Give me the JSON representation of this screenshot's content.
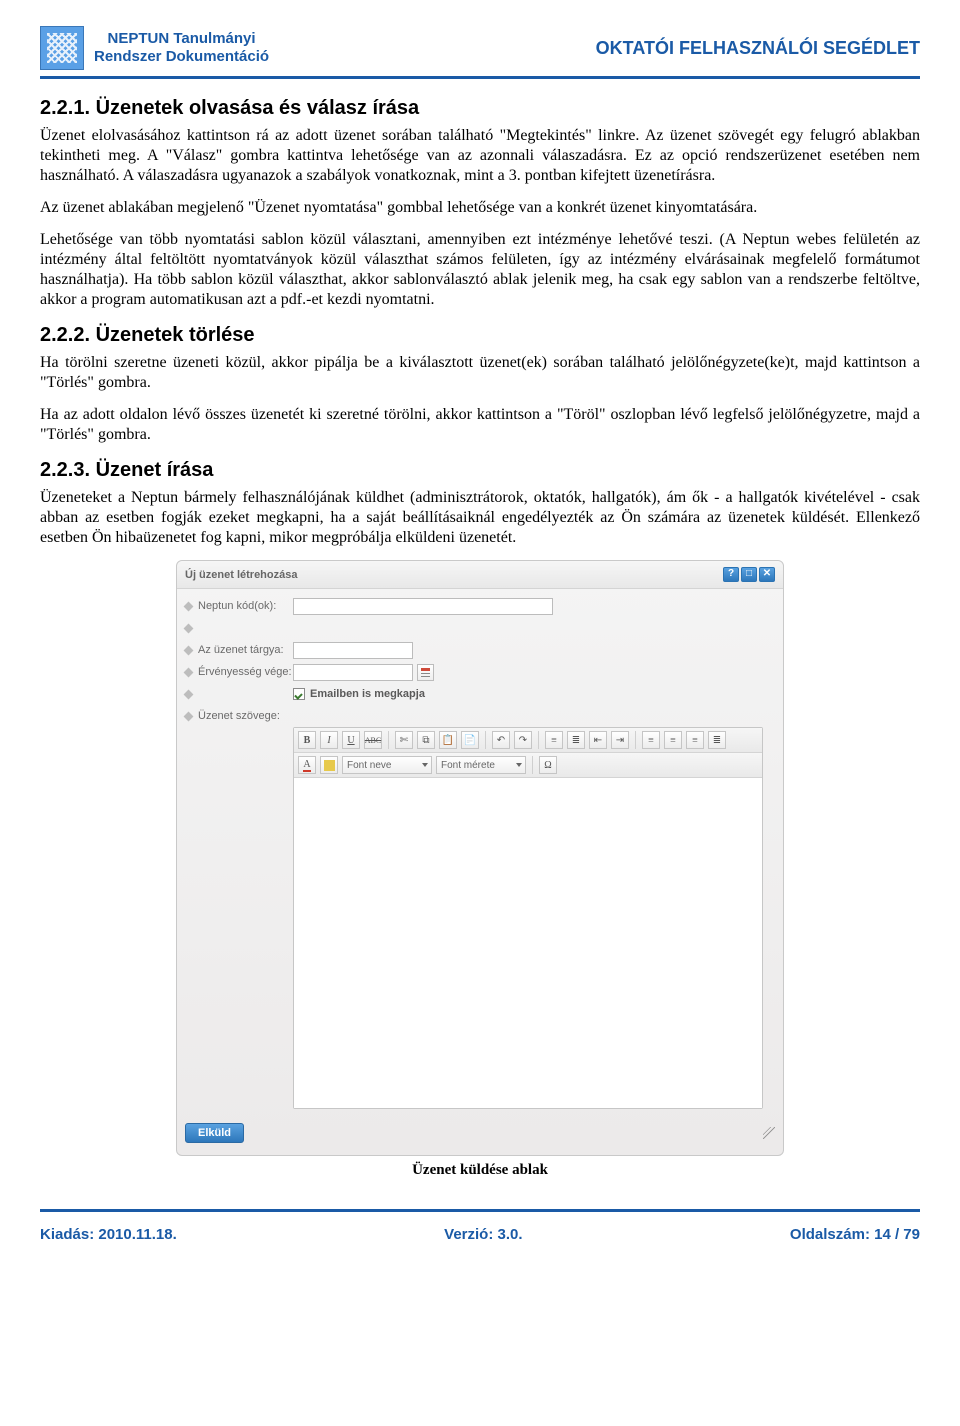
{
  "header": {
    "brand_line1": "NEPTUN Tanulmányi",
    "brand_line2": "Rendszer Dokumentáció",
    "title": "OKTATÓI FELHASZNÁLÓI SEGÉDLET"
  },
  "sections": {
    "s1": {
      "heading": "2.2.1. Üzenetek olvasása és válasz írása",
      "p1": "Üzenet elolvasásához kattintson rá az adott üzenet sorában található \"Megtekintés\" linkre. Az üzenet szövegét egy felugró ablakban tekintheti meg. A \"Válasz\" gombra kattintva lehetősége van az azonnali válaszadásra. Ez az opció rendszerüzenet esetében nem használható. A válaszadásra ugyanazok a szabályok vonatkoznak, mint a 3. pontban kifejtett üzenetírásra.",
      "p2": "Az üzenet ablakában megjelenő \"Üzenet nyomtatása\" gombbal lehetősége van a konkrét üzenet kinyomtatására.",
      "p3": "Lehetősége van több nyomtatási sablon közül választani, amennyiben ezt intézménye lehetővé teszi. (A Neptun webes felületén az intézmény által feltöltött nyomtatványok közül választhat számos felületen, így az intézmény elvárásainak megfelelő formátumot használhatja). Ha több sablon közül választhat, akkor sablonválasztó ablak jelenik meg, ha csak egy sablon van a rendszerbe feltöltve, akkor a program automatikusan azt a pdf.-et kezdi nyomtatni."
    },
    "s2": {
      "heading": "2.2.2. Üzenetek törlése",
      "p1": "Ha törölni szeretne üzeneti közül, akkor pipálja be a kiválasztott üzenet(ek) sorában található jelölőnégyzete(ke)t, majd kattintson a \"Törlés\" gombra.",
      "p2": "Ha az adott oldalon lévő összes üzenetét ki szeretné törölni, akkor kattintson a \"Töröl\" oszlopban lévő legfelső jelölőnégyzetre, majd a \"Törlés\" gombra."
    },
    "s3": {
      "heading": "2.2.3. Üzenet írása",
      "p1": "Üzeneteket a Neptun bármely felhasználójának küldhet (adminisztrátorok, oktatók, hallgatók), ám ők - a hallgatók kivételével - csak abban az esetben fogják ezeket megkapni, ha a saját beállításaiknál engedélyezték az Ön számára az üzenetek küldését. Ellenkező esetben Ön hibaüzenetet fog kapni, mikor megpróbálja elküldeni üzenetét."
    }
  },
  "dialog": {
    "title": "Új üzenet létrehozása",
    "buttons": {
      "help": "?",
      "expand": "□",
      "close": "✕"
    },
    "fields": {
      "code": "Neptun kód(ok):",
      "subject": "Az üzenet tárgya:",
      "validity": "Érvényesség vége:",
      "email_checkbox": "Emailben is megkapja",
      "body": "Üzenet szövege:"
    },
    "toolbar": {
      "bold": "B",
      "italic": "I",
      "underline": "U",
      "strike": "ABC",
      "font_name": "Font neve",
      "font_size": "Font mérete",
      "omega": "Ω"
    },
    "send": "Elküld"
  },
  "caption": "Üzenet küldése ablak",
  "footer": {
    "left": "Kiadás: 2010.11.18.",
    "mid": "Verzió: 3.0.",
    "right": "Oldalszám: 14 / 79"
  }
}
